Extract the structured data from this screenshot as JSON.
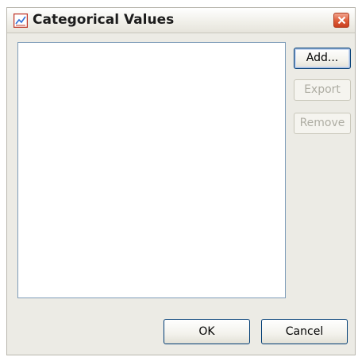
{
  "window": {
    "title": "Categorical Values"
  },
  "buttons": {
    "add": "Add...",
    "export": "Export",
    "remove": "Remove",
    "ok": "OK",
    "cancel": "Cancel"
  },
  "colors": {
    "window_bg": "#ecebe5",
    "close_button": "#dd5a36",
    "button_border": "#003c74",
    "disabled_text": "#aeada3"
  },
  "icons": {
    "app": "chart-icon",
    "close": "close-icon"
  },
  "list": {
    "items": []
  }
}
